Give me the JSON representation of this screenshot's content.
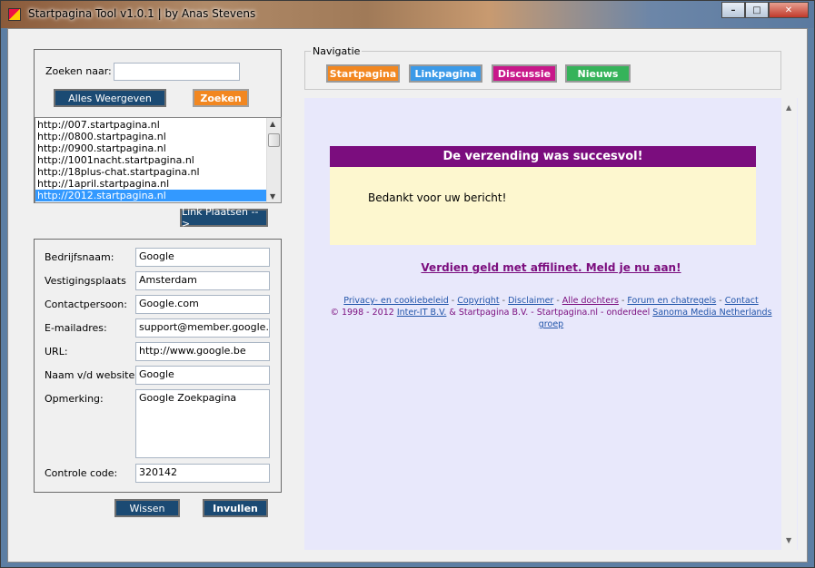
{
  "window": {
    "title": "Startpagina Tool v1.0.1 | by Anas Stevens",
    "min_glyph": "–",
    "max_glyph": "□",
    "close_glyph": "✕"
  },
  "search": {
    "label": "Zoeken naar:",
    "value": "",
    "show_all_label": "Alles Weergeven",
    "search_label": "Zoeken"
  },
  "list": {
    "items": [
      "http://007.startpagina.nl",
      "http://0800.startpagina.nl",
      "http://0900.startpagina.nl",
      "http://1001nacht.startpagina.nl",
      "http://18plus-chat.startpagina.nl",
      "http://1april.startpagina.nl",
      "http://2012.startpagina.nl"
    ],
    "selected_index": 6
  },
  "link_button": "Link Plaatsen -->",
  "form": {
    "company_label": "Bedrijfsnaam:",
    "company": "Google",
    "city_label": "Vestigingsplaats",
    "city": "Amsterdam",
    "contact_label": "Contactpersoon:",
    "contact": "Google.com",
    "email_label": "E-mailadres:",
    "email": "support@member.google.com",
    "url_label": "URL:",
    "url": "http://www.google.be",
    "site_label": "Naam v/d website:",
    "site": "Google",
    "remark_label": "Opmerking:",
    "remark": "Google Zoekpagina",
    "code_label": "Controle code:",
    "code": "320142"
  },
  "actions": {
    "clear": "Wissen",
    "fill": "Invullen"
  },
  "nav": {
    "legend": "Navigatie",
    "buttons": [
      {
        "label": "Startpagina",
        "color": "#f28720"
      },
      {
        "label": "Linkpagina",
        "color": "#3b9ae8"
      },
      {
        "label": "Discussie",
        "color": "#c8188a"
      },
      {
        "label": "Nieuws",
        "color": "#35b35a"
      }
    ]
  },
  "web": {
    "success_title": "De verzending was succesvol!",
    "success_msg": "Bedankt voor uw bericht!",
    "promo": "Verdien geld met affilinet. Meld je nu aan!",
    "footer": {
      "links1": [
        "Privacy- en cookiebeleid",
        "Copyright",
        "Disclaimer",
        "Alle dochters",
        "Forum en chatregels",
        "Contact"
      ],
      "copy": "© 1998 - 2012",
      "inter": "Inter-IT B.V.",
      "mid": "& Startpagina B.V. - Startpagina.nl - onderdeel",
      "sanoma": "Sanoma Media Netherlands",
      "groep": "groep"
    }
  },
  "colors": {
    "brand_purple": "#7b0d7e",
    "dark_button": "#1b4a73"
  }
}
